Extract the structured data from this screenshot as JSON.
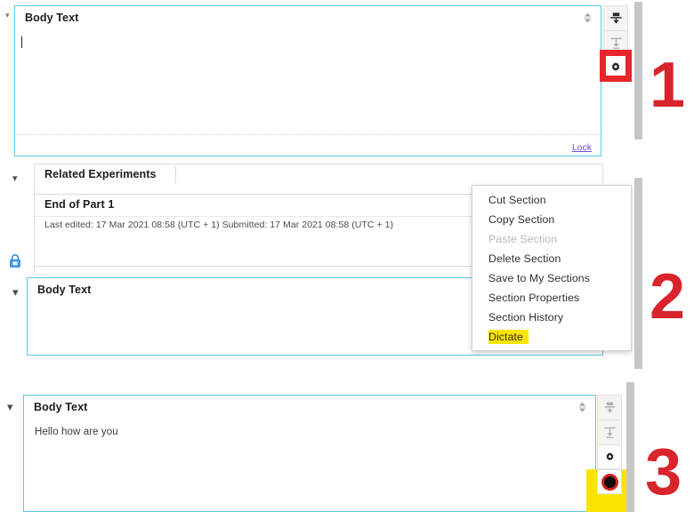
{
  "app": {
    "accent_blue": "#5bc8e8",
    "annotation_red": "#d8242b",
    "highlight_yellow": "#fbe400",
    "link_purple": "#6c4fd0"
  },
  "annotations": [
    {
      "label": "1"
    },
    {
      "label": "2"
    },
    {
      "label": "3"
    }
  ],
  "panel1": {
    "section_title": "Body Text",
    "editor_value": "",
    "lock_link": "Lock",
    "rail": [
      {
        "icon": "insert-section-above-icon",
        "state": "enabled"
      },
      {
        "icon": "insert-section-below-icon",
        "state": "disabled"
      },
      {
        "icon": "gear-icon",
        "state": "highlighted"
      }
    ]
  },
  "panel2": {
    "related_section_title": "Related Experiments",
    "end_part_title": "End of Part 1",
    "meta_text": "Last edited: 17 Mar 2021 08:58 (UTC + 1) Submitted: 17 Mar 2021 08:58 (UTC + 1)",
    "lock_icon": "padlock-icon",
    "body_section_title": "Body Text",
    "context_menu": [
      {
        "label": "Cut Section",
        "state": "enabled",
        "highlighted": false
      },
      {
        "label": "Copy Section",
        "state": "enabled",
        "highlighted": false
      },
      {
        "label": "Paste Section",
        "state": "disabled",
        "highlighted": false
      },
      {
        "label": "Delete Section",
        "state": "enabled",
        "highlighted": false
      },
      {
        "label": "Save to My Sections",
        "state": "enabled",
        "highlighted": false
      },
      {
        "label": "Section Properties",
        "state": "enabled",
        "highlighted": false
      },
      {
        "label": "Section History",
        "state": "enabled",
        "highlighted": false
      },
      {
        "label": "Dictate",
        "state": "enabled",
        "highlighted": true
      }
    ]
  },
  "panel3": {
    "section_title": "Body Text",
    "editor_value": "Hello how are you",
    "rail": [
      {
        "icon": "insert-section-above-icon",
        "state": "disabled"
      },
      {
        "icon": "insert-section-below-icon",
        "state": "disabled"
      },
      {
        "icon": "gear-icon",
        "state": "enabled"
      },
      {
        "icon": "record-icon",
        "state": "highlighted"
      }
    ]
  }
}
